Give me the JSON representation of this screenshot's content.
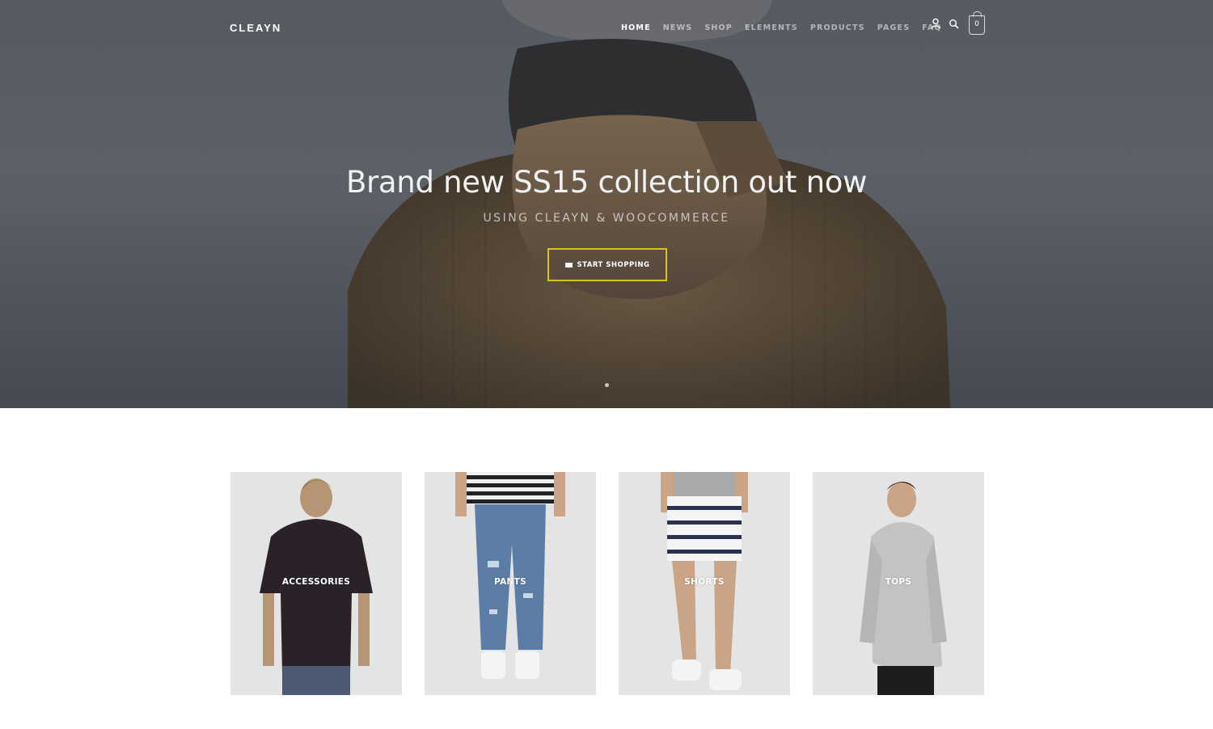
{
  "brand": {
    "logo": "CLEAYN"
  },
  "nav": {
    "items": [
      {
        "label": "HOME",
        "active": true
      },
      {
        "label": "NEWS"
      },
      {
        "label": "SHOP"
      },
      {
        "label": "ELEMENTS"
      },
      {
        "label": "PRODUCTS"
      },
      {
        "label": "PAGES"
      },
      {
        "label": "FAQ"
      }
    ],
    "icons": [
      "user-icon",
      "search-icon",
      "cart-icon"
    ],
    "cart_count": "0"
  },
  "hero": {
    "title": "Brand new SS15 collection out now",
    "subtitle": "USING CLEAYN & WOOCOMMERCE",
    "cta_label": "START SHOPPING",
    "cta_icon": "card-icon",
    "accent_color": "#d8c21e"
  },
  "categories": [
    {
      "label": "ACCESSORIES"
    },
    {
      "label": "PANTS"
    },
    {
      "label": "SHORTS"
    },
    {
      "label": "TOPS"
    }
  ]
}
